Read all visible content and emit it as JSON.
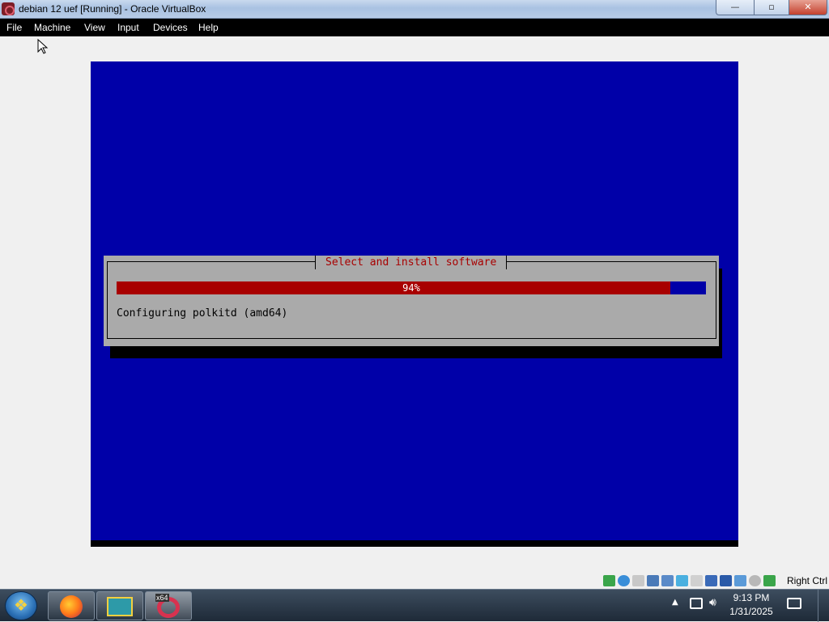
{
  "window": {
    "title": "debian 12 uef [Running] - Oracle VirtualBox",
    "controls": {
      "minimize": "—",
      "maximize": "▫",
      "close": "✕"
    }
  },
  "menu": [
    "File",
    "Machine",
    "View",
    "Input",
    "Devices",
    "Help"
  ],
  "installer": {
    "dialog_title": "Select and install software",
    "progress_label": "94%",
    "progress_fraction": 0.94,
    "status_text": "Configuring polkitd (amd64)",
    "colors": {
      "background": "#0000a8",
      "dialog": "#aaaaaa",
      "title": "#a80000",
      "progress_fill": "#a80000",
      "progress_empty": "#0000a8"
    }
  },
  "statusbar": {
    "icons": [
      "hard-disk-icon",
      "optical-drive-icon",
      "floppy-icon",
      "audio-icon",
      "network-icon",
      "usb-icon",
      "shared-folders-icon",
      "display-icon",
      "recording-icon",
      "cpu-icon",
      "mouse-integration-icon",
      "keyboard-icon"
    ],
    "host_key": "Right Ctrl"
  },
  "taskbar": {
    "apps": [
      "firefox-icon",
      "file-explorer-icon",
      "virtualbox-icon"
    ],
    "vbox_badge": "x64",
    "time": "9:13 PM",
    "date": "1/31/2025"
  }
}
